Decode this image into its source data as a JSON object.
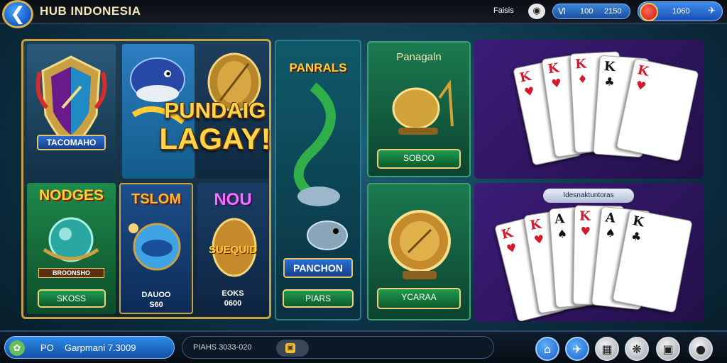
{
  "header": {
    "back_icon": "arrow-left-icon",
    "title": "HUB INDONESIA",
    "label": "Faisis",
    "film_icon": "film-reel-icon",
    "stats": {
      "icon": "tally-icon",
      "value_1": "100",
      "value_2": "2150"
    },
    "coins": {
      "value": "1060",
      "icon": "plane-icon"
    }
  },
  "tiles": {
    "crest": {
      "label": "TACOMAHO"
    },
    "headline": {
      "line1": "PUNDAIG",
      "line2": "LAGAY!"
    },
    "nodges": {
      "title": "NODGES",
      "label": "BROONSHO",
      "badge": "SKOSS"
    },
    "tslom": {
      "title": "TSLOM",
      "line1": "DAUOO",
      "line2": "S60"
    },
    "nou": {
      "title": "NOU",
      "label": "SUEQUID",
      "line1": "EOKS",
      "line2": "0600"
    },
    "fish": {
      "title": "PANRALS",
      "label": "PANCHON",
      "badge": "PIARS"
    },
    "trophy_top": {
      "title": "Panagaln",
      "badge": "SOBOO"
    },
    "trophy_bottom": {
      "badge": "YCARAA"
    },
    "cards_bottom": {
      "label": "Idesnaktuntoras"
    }
  },
  "footer": {
    "avatar_icon": "leaf-icon",
    "prefix": "PO",
    "player": "Garpmani 7.3009",
    "info": "PIAHS 3033-020",
    "nav_icons": [
      "home-icon",
      "plane-icon",
      "grid-icon",
      "settings-icon",
      "gamepad-icon",
      "menu-icon"
    ]
  },
  "colors": {
    "gold": "#c9a043",
    "accent_blue": "#1b5fc4",
    "green": "#1b7a50",
    "purple": "#3c1c78"
  }
}
